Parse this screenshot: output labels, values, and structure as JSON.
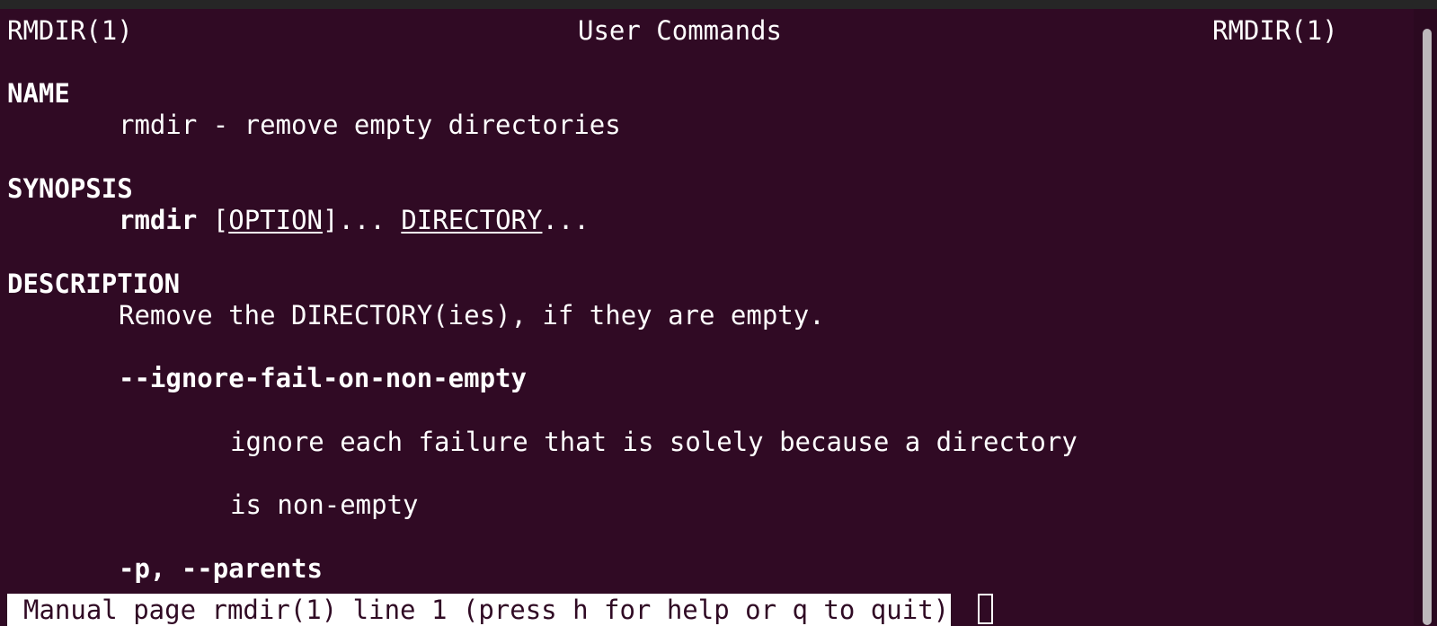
{
  "header": {
    "left": "RMDIR(1)",
    "center": "User Commands",
    "right": "RMDIR(1)"
  },
  "sections": {
    "name_heading": "NAME",
    "name_text": "rmdir - remove empty directories",
    "synopsis_heading": "SYNOPSIS",
    "synopsis_cmd": "rmdir",
    "synopsis_open": "[",
    "synopsis_option": "OPTION",
    "synopsis_close": "]... ",
    "synopsis_dir": "DIRECTORY",
    "synopsis_ellipsis": "...",
    "description_heading": "DESCRIPTION",
    "description_text": "Remove the DIRECTORY(ies), if they are empty.",
    "opt1_flag": "--ignore-fail-on-non-empty",
    "opt1_desc_line1": "ignore each failure that is solely because a directory",
    "opt1_desc_line2": "is non-empty",
    "opt2_flag": "-p, --parents"
  },
  "status": {
    "text": "Manual page rmdir(1) line 1 (press h for help or q to quit)"
  },
  "colors": {
    "background": "#300a24",
    "foreground": "#ffffff"
  }
}
